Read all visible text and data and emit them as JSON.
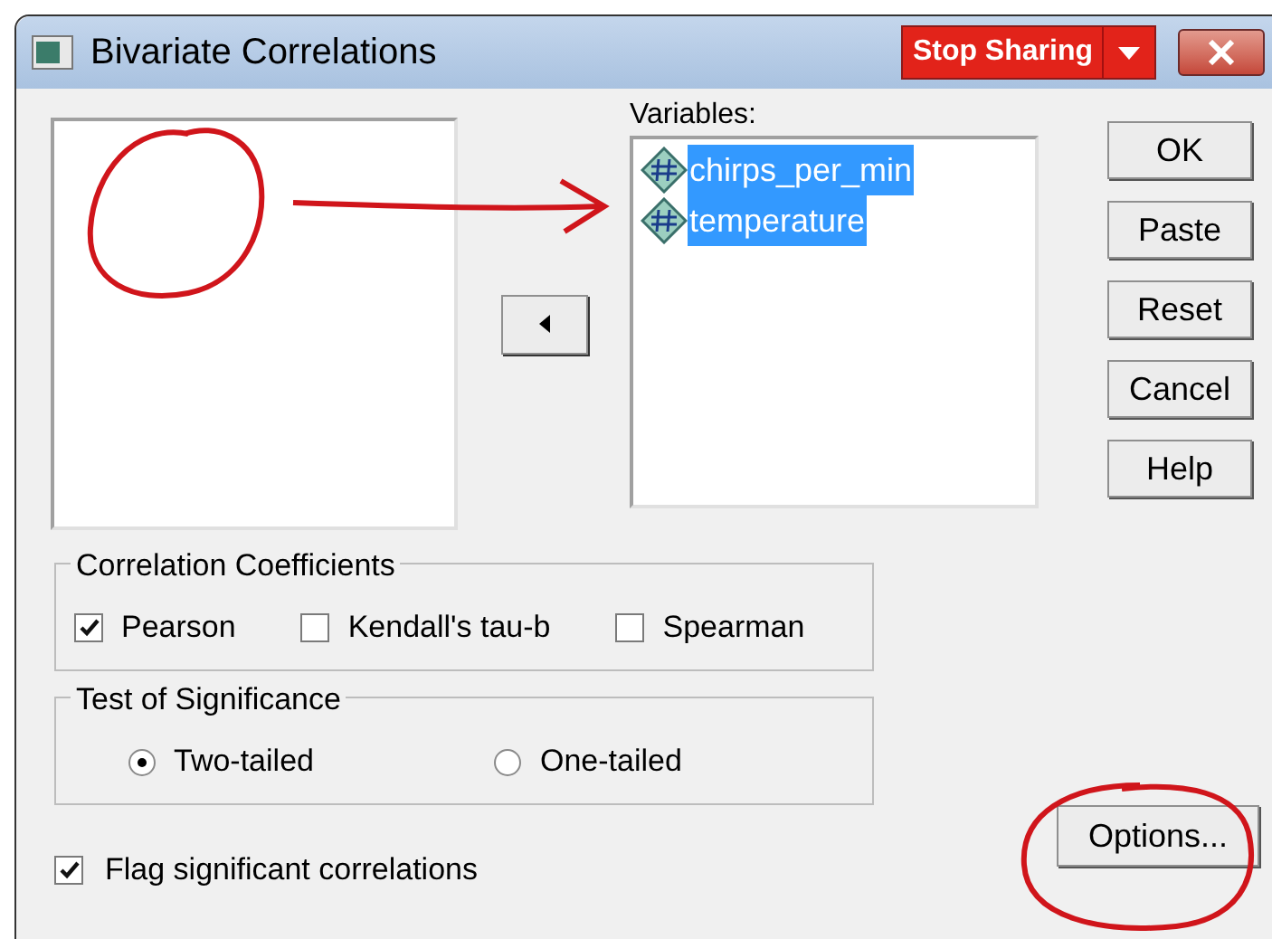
{
  "window": {
    "title": "Bivariate Correlations",
    "share_button": "Stop Sharing"
  },
  "variables": {
    "label": "Variables:",
    "items": [
      {
        "name": "chirps_per_min",
        "selected": true
      },
      {
        "name": "temperature",
        "selected": true
      }
    ]
  },
  "buttons": [
    "OK",
    "Paste",
    "Reset",
    "Cancel",
    "Help"
  ],
  "correlation_coefficients": {
    "title": "Correlation Coefficients",
    "options": [
      {
        "label": "Pearson",
        "checked": true
      },
      {
        "label": "Kendall's tau-b",
        "checked": false
      },
      {
        "label": "Spearman",
        "checked": false
      }
    ]
  },
  "test_of_significance": {
    "title": "Test of Significance",
    "options": [
      {
        "label": "Two-tailed",
        "selected": true
      },
      {
        "label": "One-tailed",
        "selected": false
      }
    ]
  },
  "flag_significant": {
    "label": "Flag significant correlations",
    "checked": true
  },
  "options_button": "Options..."
}
